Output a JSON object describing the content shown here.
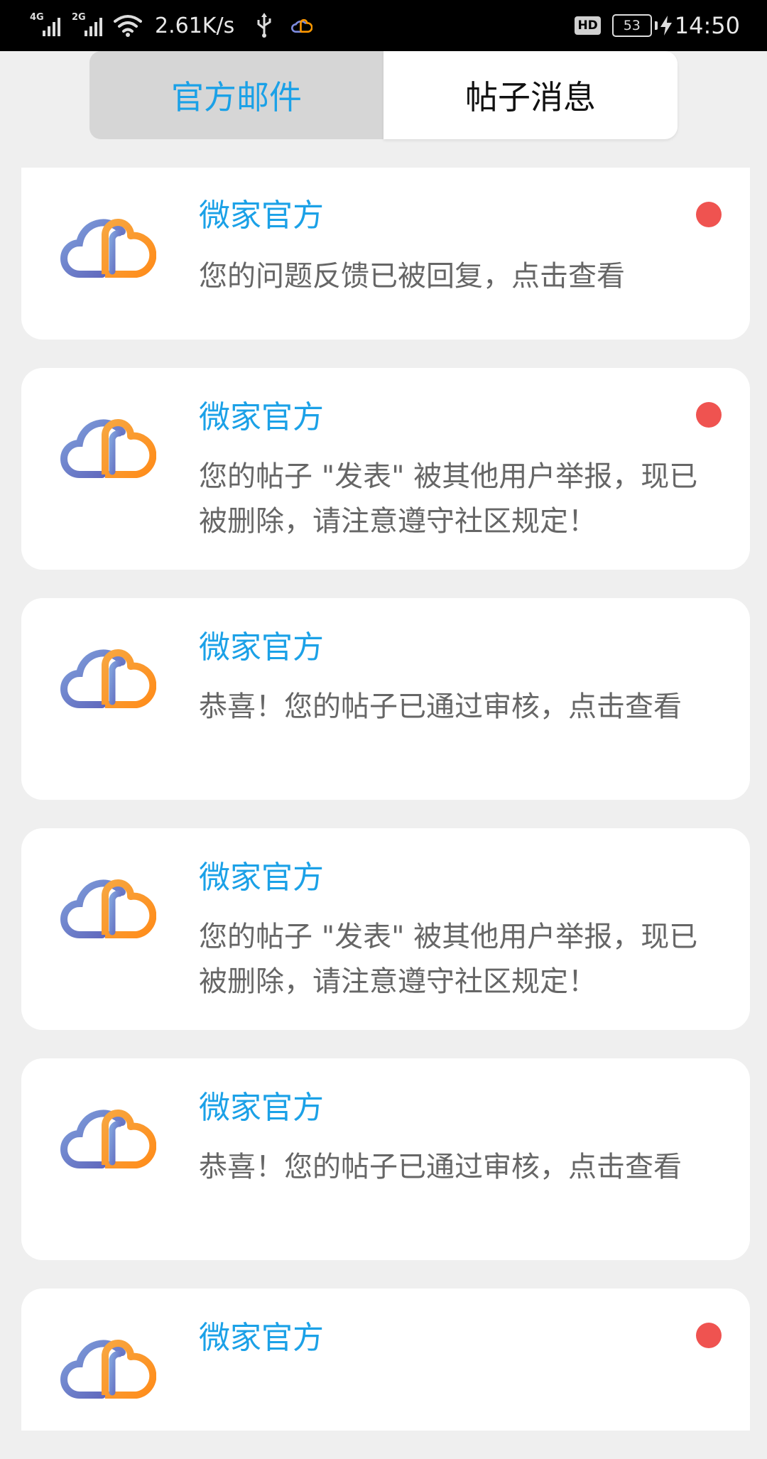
{
  "status_bar": {
    "sim1": "4G",
    "sim2": "2G",
    "speed": "2.61K/s",
    "hd": "HD",
    "battery": "53",
    "time": "14:50",
    "icons": [
      "signal-icon",
      "wifi-icon",
      "usb-icon",
      "cloud-app-icon",
      "bolt-icon"
    ]
  },
  "tabs": {
    "official_mail": "官方邮件",
    "post_messages": "帖子消息",
    "active": "official_mail"
  },
  "colors": {
    "accent": "#1ba1e7",
    "unread_dot": "#ef5350",
    "background": "#efefef",
    "logo_blue": "#5c6bc0",
    "logo_orange": "#ff9800"
  },
  "messages": [
    {
      "sender": "微家官方",
      "text": "您的问题反馈已被回复，点击查看",
      "unread": true
    },
    {
      "sender": "微家官方",
      "text": "您的帖子 \"发表\" 被其他用户举报，现已被删除，请注意遵守社区规定！",
      "unread": true
    },
    {
      "sender": "微家官方",
      "text": "恭喜！您的帖子已通过审核，点击查看",
      "unread": false
    },
    {
      "sender": "微家官方",
      "text": "您的帖子 \"发表\" 被其他用户举报，现已被删除，请注意遵守社区规定！",
      "unread": false
    },
    {
      "sender": "微家官方",
      "text": "恭喜！您的帖子已通过审核，点击查看",
      "unread": false
    },
    {
      "sender": "微家官方",
      "text": "",
      "unread": true
    }
  ]
}
